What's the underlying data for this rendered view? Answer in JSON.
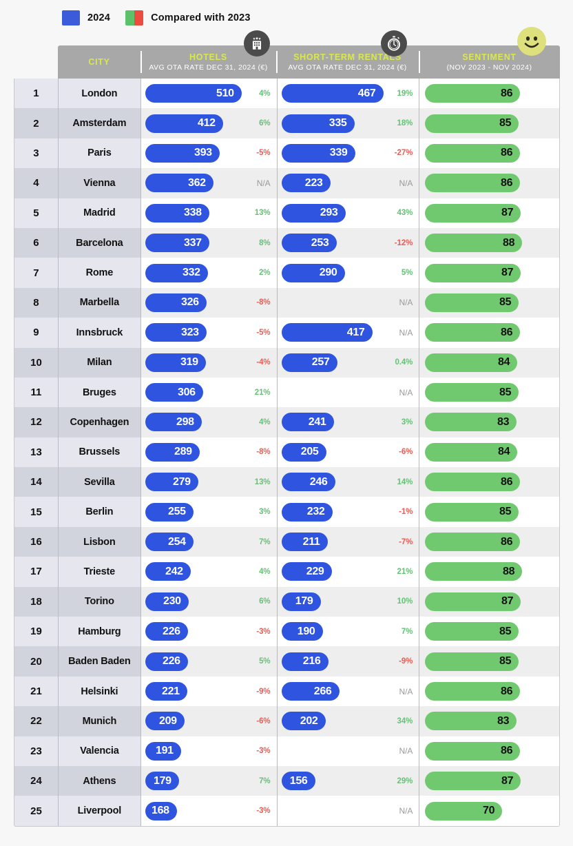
{
  "legend": {
    "items": [
      {
        "label": "2024",
        "swatch": "blue-swatch",
        "color": "#3b5bdb"
      },
      {
        "label": "Compared with 2023",
        "swatch": "split-green-red-swatch",
        "colors": [
          "#5cc16a",
          "#ec4b3f"
        ]
      }
    ]
  },
  "header": {
    "icons": [
      {
        "name": "hotel-building-icon",
        "column": "hotels"
      },
      {
        "name": "stopwatch-icon",
        "column": "short-term-rentals"
      },
      {
        "name": "smiley-face-icon",
        "column": "sentiment",
        "color": "#dde07c"
      }
    ],
    "columns": [
      {
        "key": "rank",
        "title": "",
        "sub": ""
      },
      {
        "key": "city",
        "title": "CITY",
        "sub": ""
      },
      {
        "key": "hotels",
        "title": "HOTELS",
        "sub": "AVG OTA RATE DEC 31, 2024 (€)"
      },
      {
        "key": "str",
        "title": "SHORT-TERM RENTALS",
        "sub": "AVG OTA RATE DEC 31, 2024 (€)"
      },
      {
        "key": "sentiment",
        "title": "SENTIMENT",
        "sub": "(NOV 2023 - NOV 2024)"
      }
    ],
    "title_color": "#d9e84b",
    "band_color": "#a8a8a8"
  },
  "chart_data": {
    "type": "bar",
    "title": "European city hotel and short-term rental rates with sentiment",
    "orientation": "horizontal",
    "columns": [
      "Rank",
      "City",
      "Hotels AVG OTA rate Dec 31 2024 (€)",
      "Hotels % vs 2023",
      "Short-term rentals AVG OTA rate Dec 31 2024 (€)",
      "Short-term rentals % vs 2023",
      "Sentiment (Nov 2023 - Nov 2024)"
    ],
    "series": [
      {
        "name": "Hotels AVG OTA rate (€)",
        "color": "#2f55e0",
        "max": 510
      },
      {
        "name": "Short-term rentals AVG OTA rate (€)",
        "color": "#2f55e0",
        "max": 467
      },
      {
        "name": "Sentiment",
        "color": "#70c96f",
        "max": 100
      }
    ],
    "rows": [
      {
        "rank": "1",
        "city": "London",
        "hotel": 510,
        "hotel_pct": "4%",
        "hotel_pct_sign": "pos",
        "str": 467,
        "str_pct": "19%",
        "str_pct_sign": "pos",
        "sentiment": 86
      },
      {
        "rank": "2",
        "city": "Amsterdam",
        "hotel": 412,
        "hotel_pct": "6%",
        "hotel_pct_sign": "pos",
        "str": 335,
        "str_pct": "18%",
        "str_pct_sign": "pos",
        "sentiment": 85
      },
      {
        "rank": "3",
        "city": "Paris",
        "hotel": 393,
        "hotel_pct": "-5%",
        "hotel_pct_sign": "neg",
        "str": 339,
        "str_pct": "-27%",
        "str_pct_sign": "neg",
        "sentiment": 86
      },
      {
        "rank": "4",
        "city": "Vienna",
        "hotel": 362,
        "hotel_pct": "N/A",
        "hotel_pct_sign": "na",
        "str": 223,
        "str_pct": "N/A",
        "str_pct_sign": "na",
        "sentiment": 86
      },
      {
        "rank": "5",
        "city": "Madrid",
        "hotel": 338,
        "hotel_pct": "13%",
        "hotel_pct_sign": "pos",
        "str": 293,
        "str_pct": "43%",
        "str_pct_sign": "pos",
        "sentiment": 87
      },
      {
        "rank": "6",
        "city": "Barcelona",
        "hotel": 337,
        "hotel_pct": "8%",
        "hotel_pct_sign": "pos",
        "str": 253,
        "str_pct": "-12%",
        "str_pct_sign": "neg",
        "sentiment": 88
      },
      {
        "rank": "7",
        "city": "Rome",
        "hotel": 332,
        "hotel_pct": "2%",
        "hotel_pct_sign": "pos",
        "str": 290,
        "str_pct": "5%",
        "str_pct_sign": "pos",
        "sentiment": 87
      },
      {
        "rank": "8",
        "city": "Marbella",
        "hotel": 326,
        "hotel_pct": "-8%",
        "hotel_pct_sign": "neg",
        "str": null,
        "str_pct": "N/A",
        "str_pct_sign": "na",
        "sentiment": 85
      },
      {
        "rank": "9",
        "city": "Innsbruck",
        "hotel": 323,
        "hotel_pct": "-5%",
        "hotel_pct_sign": "neg",
        "str": 417,
        "str_pct": "N/A",
        "str_pct_sign": "na",
        "sentiment": 86
      },
      {
        "rank": "10",
        "city": "Milan",
        "hotel": 319,
        "hotel_pct": "-4%",
        "hotel_pct_sign": "neg",
        "str": 257,
        "str_pct": "0.4%",
        "str_pct_sign": "pos",
        "sentiment": 84
      },
      {
        "rank": "11",
        "city": "Bruges",
        "hotel": 306,
        "hotel_pct": "21%",
        "hotel_pct_sign": "pos",
        "str": null,
        "str_pct": "N/A",
        "str_pct_sign": "na",
        "sentiment": 85
      },
      {
        "rank": "12",
        "city": "Copenhagen",
        "hotel": 298,
        "hotel_pct": "4%",
        "hotel_pct_sign": "pos",
        "str": 241,
        "str_pct": "3%",
        "str_pct_sign": "pos",
        "sentiment": 83
      },
      {
        "rank": "13",
        "city": "Brussels",
        "hotel": 289,
        "hotel_pct": "-8%",
        "hotel_pct_sign": "neg",
        "str": 205,
        "str_pct": "-6%",
        "str_pct_sign": "neg",
        "sentiment": 84
      },
      {
        "rank": "14",
        "city": "Sevilla",
        "hotel": 279,
        "hotel_pct": "13%",
        "hotel_pct_sign": "pos",
        "str": 246,
        "str_pct": "14%",
        "str_pct_sign": "pos",
        "sentiment": 86
      },
      {
        "rank": "15",
        "city": "Berlin",
        "hotel": 255,
        "hotel_pct": "3%",
        "hotel_pct_sign": "pos",
        "str": 232,
        "str_pct": "-1%",
        "str_pct_sign": "neg",
        "sentiment": 85
      },
      {
        "rank": "16",
        "city": "Lisbon",
        "hotel": 254,
        "hotel_pct": "7%",
        "hotel_pct_sign": "pos",
        "str": 211,
        "str_pct": "-7%",
        "str_pct_sign": "neg",
        "sentiment": 86
      },
      {
        "rank": "17",
        "city": "Trieste",
        "hotel": 242,
        "hotel_pct": "4%",
        "hotel_pct_sign": "pos",
        "str": 229,
        "str_pct": "21%",
        "str_pct_sign": "pos",
        "sentiment": 88
      },
      {
        "rank": "18",
        "city": "Torino",
        "hotel": 230,
        "hotel_pct": "6%",
        "hotel_pct_sign": "pos",
        "str": 179,
        "str_pct": "10%",
        "str_pct_sign": "pos",
        "sentiment": 87
      },
      {
        "rank": "19",
        "city": "Hamburg",
        "hotel": 226,
        "hotel_pct": "-3%",
        "hotel_pct_sign": "neg",
        "str": 190,
        "str_pct": "7%",
        "str_pct_sign": "pos",
        "sentiment": 85
      },
      {
        "rank": "20",
        "city": "Baden Baden",
        "hotel": 226,
        "hotel_pct": "5%",
        "hotel_pct_sign": "pos",
        "str": 216,
        "str_pct": "-9%",
        "str_pct_sign": "neg",
        "sentiment": 85
      },
      {
        "rank": "21",
        "city": "Helsinki",
        "hotel": 221,
        "hotel_pct": "-9%",
        "hotel_pct_sign": "neg",
        "str": 266,
        "str_pct": "N/A",
        "str_pct_sign": "na",
        "sentiment": 86
      },
      {
        "rank": "22",
        "city": "Munich",
        "hotel": 209,
        "hotel_pct": "-6%",
        "hotel_pct_sign": "neg",
        "str": 202,
        "str_pct": "34%",
        "str_pct_sign": "pos",
        "sentiment": 83
      },
      {
        "rank": "23",
        "city": "Valencia",
        "hotel": 191,
        "hotel_pct": "-3%",
        "hotel_pct_sign": "neg",
        "str": null,
        "str_pct": "N/A",
        "str_pct_sign": "na",
        "sentiment": 86
      },
      {
        "rank": "24",
        "city": "Athens",
        "hotel": 179,
        "hotel_pct": "7%",
        "hotel_pct_sign": "pos",
        "str": 156,
        "str_pct": "29%",
        "str_pct_sign": "pos",
        "sentiment": 87
      },
      {
        "rank": "25",
        "city": "Liverpool",
        "hotel": 168,
        "hotel_pct": "-3%",
        "hotel_pct_sign": "neg",
        "str": null,
        "str_pct": "N/A",
        "str_pct_sign": "na",
        "sentiment": 70
      }
    ]
  }
}
